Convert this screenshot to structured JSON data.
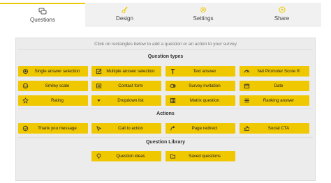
{
  "tabs": [
    {
      "label": "Questions",
      "icon": "chat-icon",
      "active": true
    },
    {
      "label": "Design",
      "icon": "brush-icon",
      "active": false
    },
    {
      "label": "Settings",
      "icon": "gear-icon",
      "active": false
    },
    {
      "label": "Share",
      "icon": "share-icon",
      "active": false
    }
  ],
  "instruction": "Click on rectangles below to add a question or an action to your survey",
  "sections": {
    "question_types": "Question types",
    "actions": "Actions",
    "library": "Question Library"
  },
  "question_types": [
    {
      "label": "Single answer selection",
      "icon": "radio-icon"
    },
    {
      "label": "Multiple answer selection",
      "icon": "checkbox-icon"
    },
    {
      "label": "Text answer",
      "icon": "text-icon"
    },
    {
      "label": "Net Promoter Score ®",
      "icon": "gauge-icon"
    },
    {
      "label": "Smiley scale",
      "icon": "smiley-icon"
    },
    {
      "label": "Contact form",
      "icon": "contact-card-icon"
    },
    {
      "label": "Survey invitation",
      "icon": "toggle-icon"
    },
    {
      "label": "Date",
      "icon": "calendar-icon"
    },
    {
      "label": "Rating",
      "icon": "star-icon"
    },
    {
      "label": "Dropdown list",
      "icon": "caret-down-icon"
    },
    {
      "label": "Matrix question",
      "icon": "grid-icon"
    },
    {
      "label": "Ranking answer",
      "icon": "list-icon"
    }
  ],
  "actions": [
    {
      "label": "Thank you message",
      "icon": "check-circle-icon"
    },
    {
      "label": "Call to action",
      "icon": "pointer-icon"
    },
    {
      "label": "Page redirect",
      "icon": "redirect-icon"
    },
    {
      "label": "Social CTA",
      "icon": "thumbs-up-icon"
    }
  ],
  "library": [
    {
      "label": "Question ideas",
      "icon": "lightbulb-icon"
    },
    {
      "label": "Saved questions",
      "icon": "folder-icon"
    }
  ],
  "colors": {
    "accent": "#f0c800",
    "panel": "#ececec",
    "tab_inactive": "#f1f1f1"
  }
}
